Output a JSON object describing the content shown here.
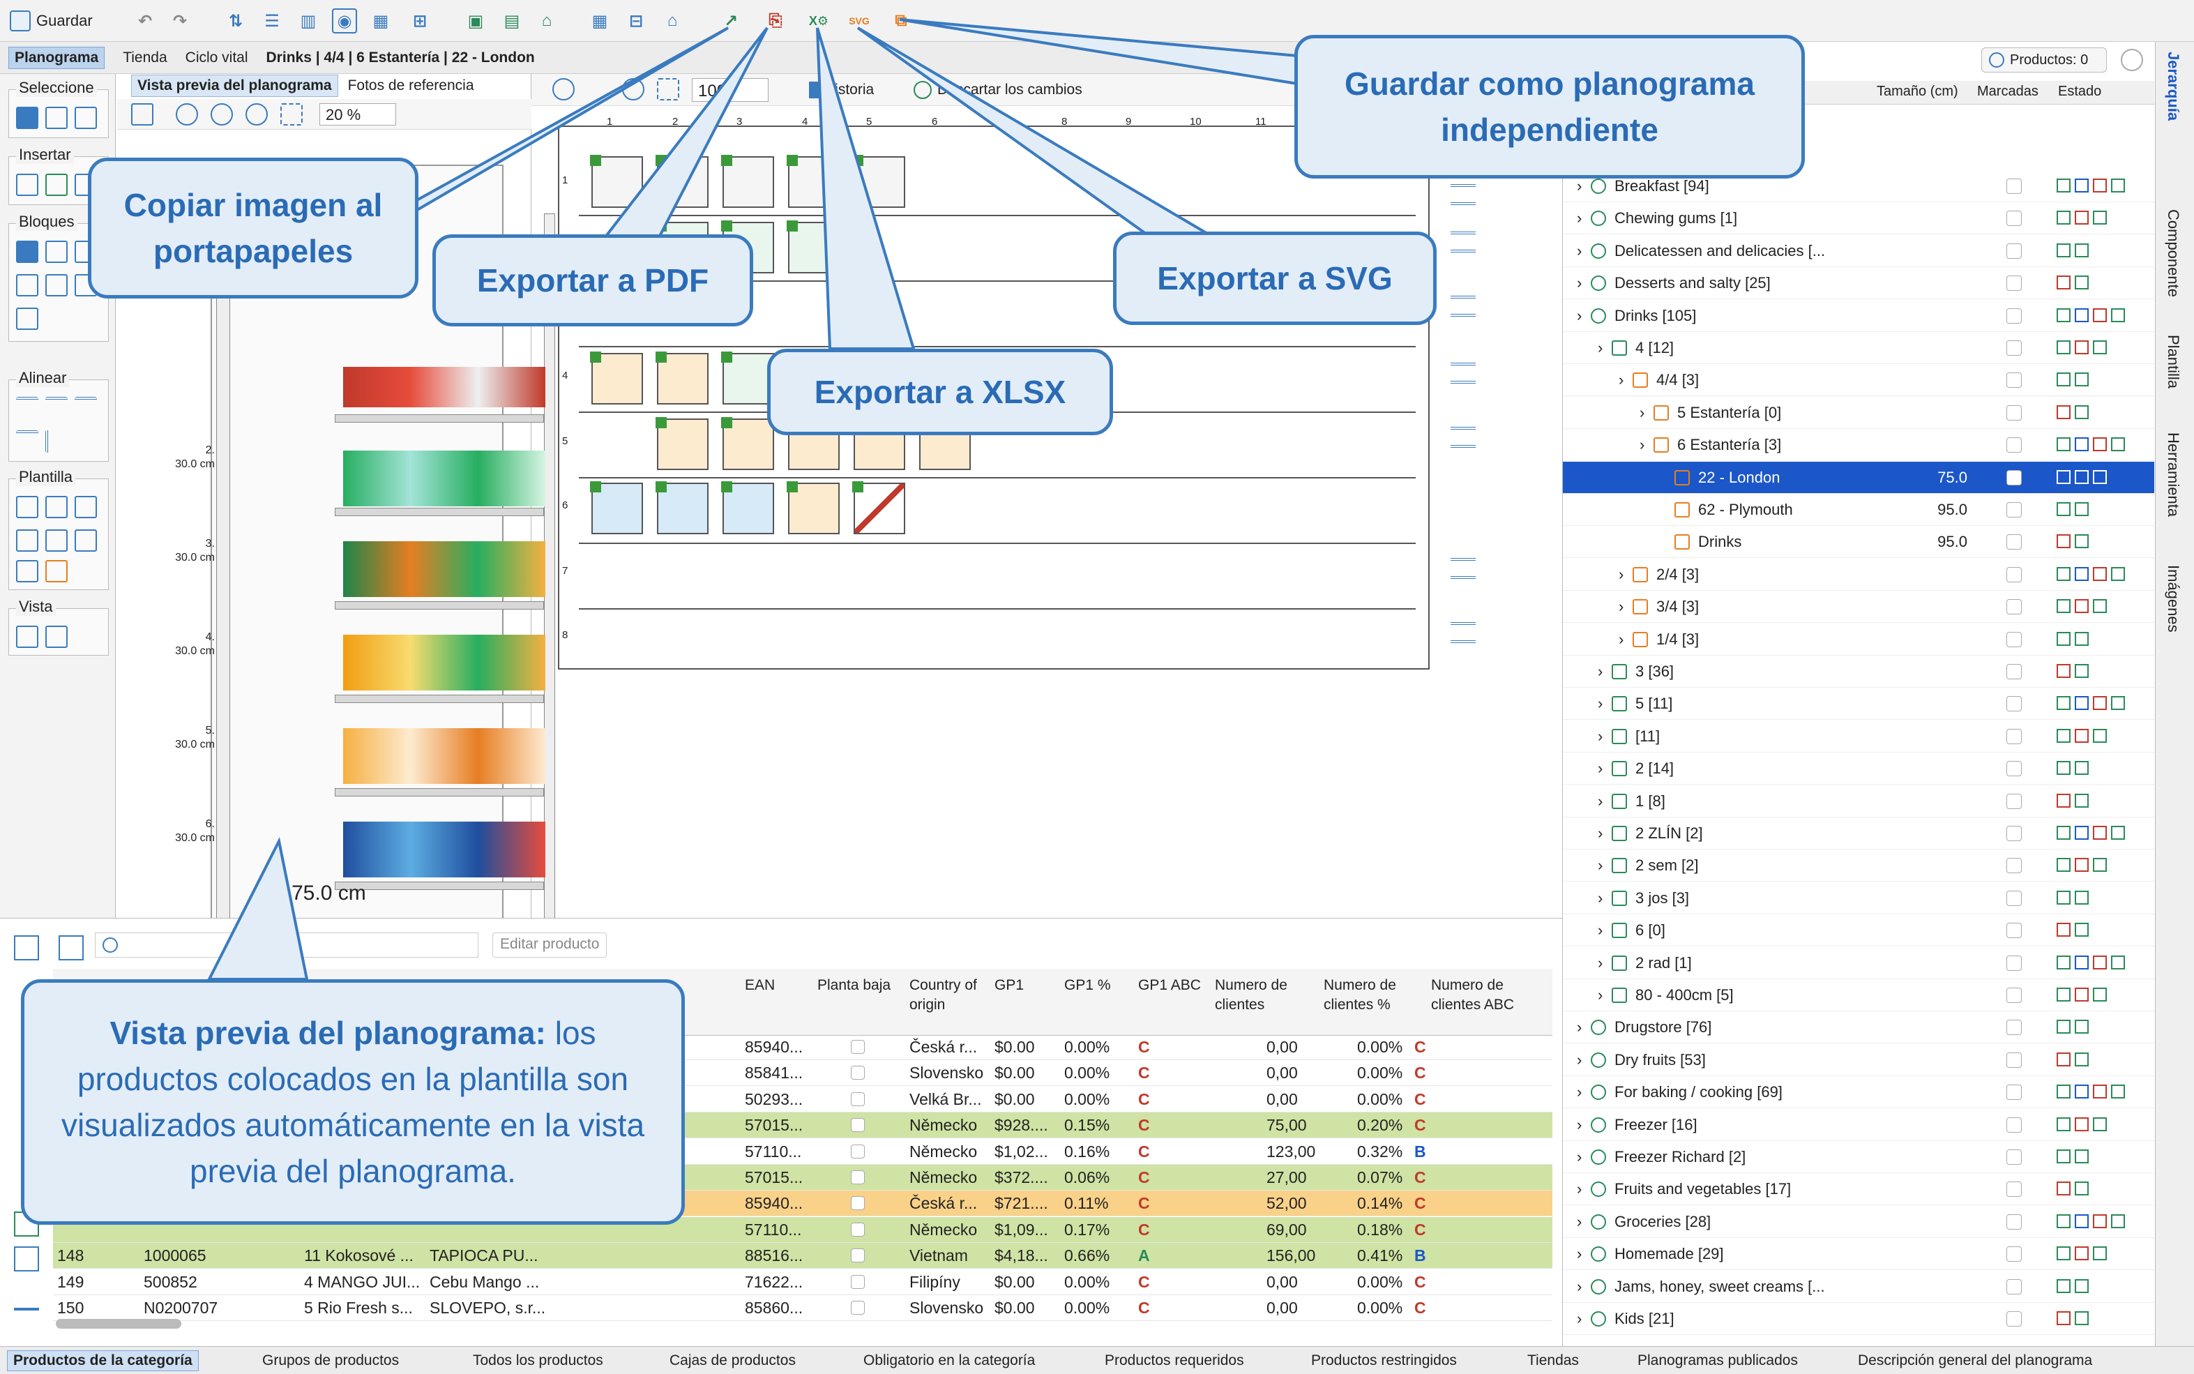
{
  "toolbar": {
    "save_label": "Guardar"
  },
  "breadcrumb": {
    "planograma": "Planograma",
    "tienda": "Tienda",
    "ciclo": "Ciclo vital",
    "path": "Drinks | 4/4 | 6 Estantería | 22 - London"
  },
  "palette": {
    "seleccione": "Seleccione",
    "insertar": "Insertar",
    "bloques": "Bloques",
    "alinear": "Alinear",
    "plantilla": "Plantilla",
    "vista": "Vista"
  },
  "preview": {
    "tab_active": "Vista previa del planograma",
    "tab_ref": "Fotos de referencia",
    "zoom": "20 %",
    "width_label": "75.0 cm",
    "shelves": [
      {
        "n": "2.",
        "h": "30.0 cm"
      },
      {
        "n": "3.",
        "h": "30.0 cm"
      },
      {
        "n": "4.",
        "h": "30.0 cm"
      },
      {
        "n": "5.",
        "h": "30.0 cm"
      },
      {
        "n": "6.",
        "h": "30.0 cm"
      }
    ]
  },
  "editor": {
    "zoom": "100",
    "historia": "Historia",
    "descartar": "Descartar los cambios",
    "cols": [
      "1",
      "2",
      "3",
      "4",
      "5",
      "6",
      "7",
      "8",
      "9",
      "10",
      "11"
    ],
    "rows": [
      "1",
      "2",
      "3",
      "4",
      "5",
      "6",
      "7",
      "8"
    ]
  },
  "right": {
    "productos": "Productos: 0",
    "col_size": "Tamaño (cm)",
    "col_marked": "Marcadas",
    "col_state": "Estado",
    "tree": [
      {
        "t": "Breakfast [94]",
        "d": 1
      },
      {
        "t": "Chewing gums [1]",
        "d": 1
      },
      {
        "t": "Delicatessen and delicacies [...",
        "d": 1
      },
      {
        "t": "Desserts and salty [25]",
        "d": 1
      },
      {
        "t": "Drinks [105]",
        "d": 1
      },
      {
        "t": "4 [12]",
        "d": 2
      },
      {
        "t": "4/4 [3]",
        "d": 3
      },
      {
        "t": "5 Estantería [0]",
        "d": 4
      },
      {
        "t": "6 Estantería [3]",
        "d": 4
      },
      {
        "t": "22 - London",
        "d": 5,
        "s": "75.0",
        "sel": true
      },
      {
        "t": "62 - Plymouth",
        "d": 5,
        "s": "95.0"
      },
      {
        "t": "Drinks",
        "d": 5,
        "s": "95.0"
      },
      {
        "t": "2/4 [3]",
        "d": 3
      },
      {
        "t": "3/4 [3]",
        "d": 3
      },
      {
        "t": "1/4 [3]",
        "d": 3
      },
      {
        "t": "3 [36]",
        "d": 2
      },
      {
        "t": "5 [11]",
        "d": 2
      },
      {
        "t": "[11]",
        "d": 2
      },
      {
        "t": "2 [14]",
        "d": 2
      },
      {
        "t": "1 [8]",
        "d": 2
      },
      {
        "t": "2 ZLÍN [2]",
        "d": 2
      },
      {
        "t": "2 sem [2]",
        "d": 2
      },
      {
        "t": "3 jos [3]",
        "d": 2
      },
      {
        "t": "6 [0]",
        "d": 2
      },
      {
        "t": "2 rad [1]",
        "d": 2
      },
      {
        "t": "80 - 400cm [5]",
        "d": 2
      },
      {
        "t": "Drugstore [76]",
        "d": 1
      },
      {
        "t": "Dry fruits [53]",
        "d": 1
      },
      {
        "t": "For baking / cooking [69]",
        "d": 1
      },
      {
        "t": "Freezer [16]",
        "d": 1
      },
      {
        "t": "Freezer Richard [2]",
        "d": 1
      },
      {
        "t": "Fruits and vegetables [17]",
        "d": 1
      },
      {
        "t": "Groceries [28]",
        "d": 1
      },
      {
        "t": "Homemade [29]",
        "d": 1
      },
      {
        "t": "Jams, honey, sweet creams [...",
        "d": 1
      },
      {
        "t": "Kids [21]",
        "d": 1
      }
    ]
  },
  "vtabs": [
    "Jerarquía",
    "Componente",
    "Plantilla",
    "Herramienta",
    "Imágenes"
  ],
  "table": {
    "edit": "Editar producto",
    "headers": [
      "EAN",
      "Planta baja",
      "Country of origin",
      "GP1",
      "GP1 %",
      "GP1 ABC",
      "Numero de clientes",
      "Numero de clientes %",
      "Numero de clientes ABC"
    ],
    "rows": [
      {
        "ean": "85940...",
        "c": "Česká r...",
        "gp": "$0.00",
        "gpp": "0.00%",
        "abc": "C",
        "n": "0,00",
        "np": "0.00%",
        "nabc": "C",
        "bg": ""
      },
      {
        "ean": "85841...",
        "c": "Slovensko",
        "gp": "$0.00",
        "gpp": "0.00%",
        "abc": "C",
        "n": "0,00",
        "np": "0.00%",
        "nabc": "C",
        "bg": ""
      },
      {
        "ean": "50293...",
        "c": "Velká Br...",
        "gp": "$0.00",
        "gpp": "0.00%",
        "abc": "C",
        "n": "0,00",
        "np": "0.00%",
        "nabc": "C",
        "bg": ""
      },
      {
        "ean": "57015...",
        "c": "Německo",
        "gp": "$928....",
        "gpp": "0.15%",
        "abc": "C",
        "n": "75,00",
        "np": "0.20%",
        "nabc": "C",
        "bg": "#cfe3a4"
      },
      {
        "ean": "57110...",
        "c": "Německo",
        "gp": "$1,02...",
        "gpp": "0.16%",
        "abc": "C",
        "n": "123,00",
        "np": "0.32%",
        "nabc": "B",
        "bg": ""
      },
      {
        "ean": "57015...",
        "c": "Německo",
        "gp": "$372....",
        "gpp": "0.06%",
        "abc": "C",
        "n": "27,00",
        "np": "0.07%",
        "nabc": "C",
        "bg": "#cfe3a4"
      },
      {
        "ean": "85940...",
        "c": "Česká r...",
        "gp": "$721....",
        "gpp": "0.11%",
        "abc": "C",
        "n": "52,00",
        "np": "0.14%",
        "nabc": "C",
        "bg": "#f9d189"
      },
      {
        "ean": "57110...",
        "c": "Německo",
        "gp": "$1,09...",
        "gpp": "0.17%",
        "abc": "C",
        "n": "69,00",
        "np": "0.18%",
        "nabc": "C",
        "bg": "#cfe3a4"
      },
      {
        "id": "148",
        "code": "1000065",
        "name": "11 Kokosové ...",
        "sup": "TAPIOCA PU...",
        "ean": "88516...",
        "c": "Vietnam",
        "gp": "$4,18...",
        "gpp": "0.66%",
        "abc": "A",
        "n": "156,00",
        "np": "0.41%",
        "nabc": "B",
        "bg": "#cfe3a4"
      },
      {
        "id": "149",
        "code": "500852",
        "name": "4 MANGO JUI...",
        "sup": "Cebu Mango ...",
        "ean": "71622...",
        "c": "Filipíny",
        "gp": "$0.00",
        "gpp": "0.00%",
        "abc": "C",
        "n": "0,00",
        "np": "0.00%",
        "nabc": "C",
        "bg": ""
      },
      {
        "id": "150",
        "code": "N0200707",
        "name": "5 Rio Fresh s...",
        "sup": "SLOVEPO, s.r...",
        "ean": "85860...",
        "c": "Slovensko",
        "gp": "$0.00",
        "gpp": "0.00%",
        "abc": "C",
        "n": "0,00",
        "np": "0.00%",
        "nabc": "C",
        "bg": ""
      }
    ]
  },
  "bottom_tabs": [
    "Productos de la categoría",
    "Grupos de productos",
    "Todos los productos",
    "Cajas de productos",
    "Obligatorio en la categoría",
    "Productos requeridos",
    "Productos restringidos",
    "Tiendas",
    "Planogramas publicados",
    "Descripción general del planograma"
  ],
  "callouts": {
    "copy": "Copiar imagen al portapapeles",
    "pdf": "Exportar a PDF",
    "xlsx": "Exportar a XLSX",
    "svg": "Exportar a SVG",
    "save_indep": "Guardar como planograma independiente",
    "preview_title": "Vista previa del planograma:",
    "preview_body": "los productos colocados en la plantilla son visualizados automáticamente en la vista previa del planograma."
  },
  "colors": {
    "accent": "#3a7bbf",
    "selection": "#1b57c9",
    "green": "#cfe3a4",
    "orange": "#f9d189"
  }
}
